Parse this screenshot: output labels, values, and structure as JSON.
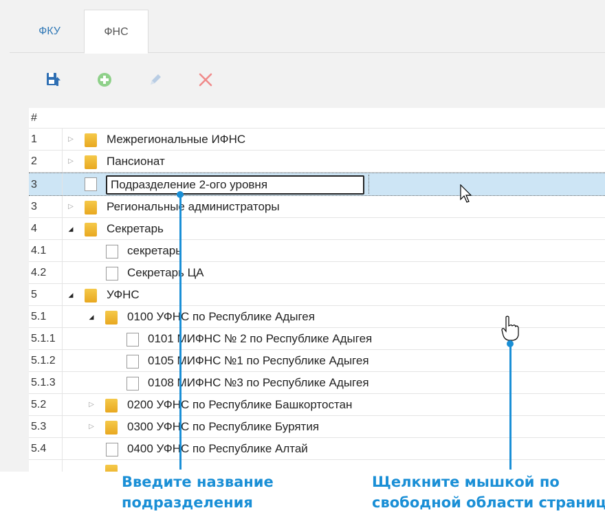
{
  "tabs": [
    {
      "label": "ФКУ"
    },
    {
      "label": "ФНС"
    }
  ],
  "toolbar": {
    "save_icon": "save-upload-icon",
    "add_icon": "plus-circle-icon",
    "edit_icon": "pencil-icon",
    "delete_icon": "close-x-icon"
  },
  "grid": {
    "header": "#",
    "edit_value": "Подразделение 2-ого уровня",
    "rows": [
      {
        "num": "1",
        "label": "Межрегиональные ИФНС"
      },
      {
        "num": "2",
        "label": "Пансионат"
      },
      {
        "num": "3",
        "label": ""
      },
      {
        "num": "3",
        "label": "Региональные администраторы"
      },
      {
        "num": "4",
        "label": "Секретарь"
      },
      {
        "num": "4.1",
        "label": "секретарь"
      },
      {
        "num": "4.2",
        "label": "Секретарь ЦА"
      },
      {
        "num": "5",
        "label": "УФНС"
      },
      {
        "num": "5.1",
        "label": "0100 УФНС по Республике Адыгея"
      },
      {
        "num": "5.1.1",
        "label": "0101 МИФНС № 2 по Республике Адыгея"
      },
      {
        "num": "5.1.2",
        "label": "0105 МИФНС №1 по Республике Адыгея"
      },
      {
        "num": "5.1.3",
        "label": "0108 МИФНС №3 по Республике Адыгея"
      },
      {
        "num": "5.2",
        "label": "0200 УФНС по Республике Башкортостан"
      },
      {
        "num": "5.3",
        "label": "0300 УФНС по Республике Бурятия"
      },
      {
        "num": "5.4",
        "label": "0400 УФНС по Республике Алтай"
      }
    ]
  },
  "annotations": {
    "left_line1": "Введите название",
    "left_line2": "подразделения",
    "right_line1": "Щелкните мышкой по",
    "right_line2": "свободной области страницы"
  },
  "colors": {
    "accent": "#1a8fd6",
    "selected_row": "#cde5f5"
  }
}
